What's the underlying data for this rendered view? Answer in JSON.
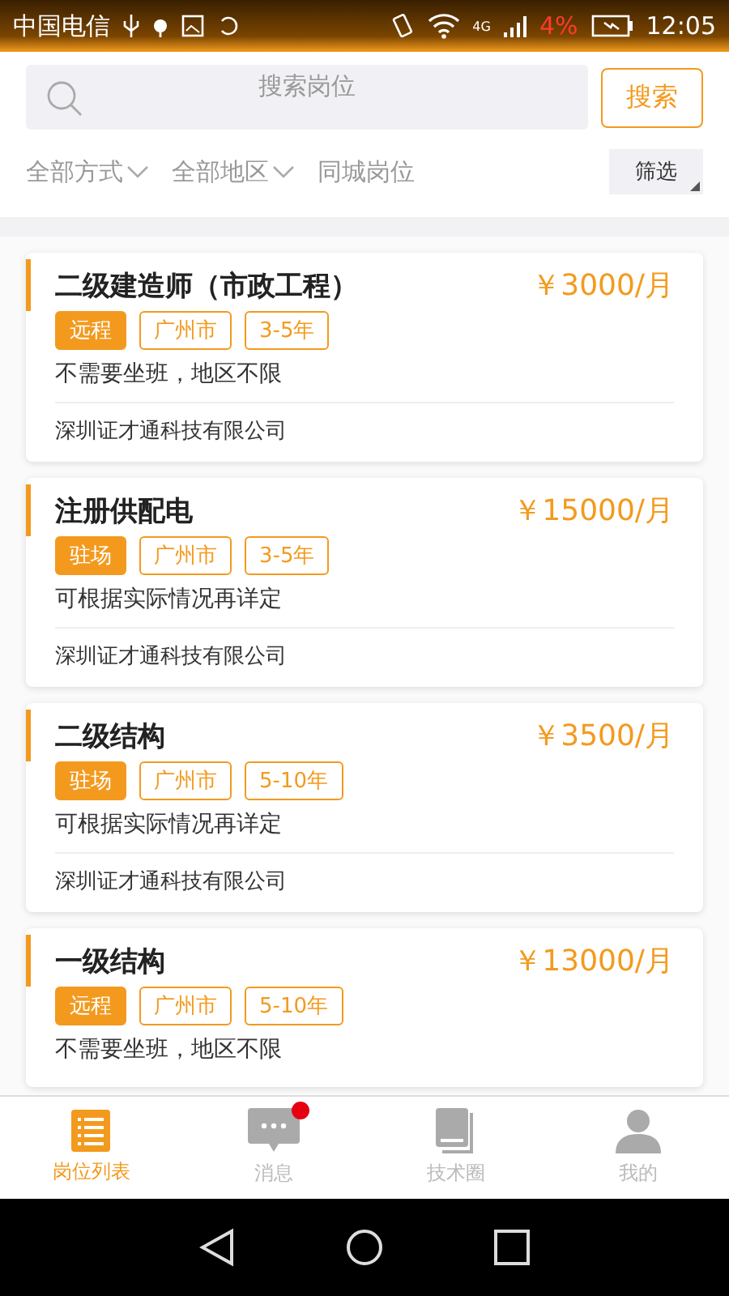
{
  "status_bar": {
    "carrier": "中国电信",
    "network": "4G",
    "battery": "4%",
    "time": "12:05"
  },
  "search": {
    "placeholder": "搜索岗位",
    "button": "搜索"
  },
  "filters": [
    {
      "label": "全部方式",
      "dropdown": true
    },
    {
      "label": "全部地区",
      "dropdown": true
    },
    {
      "label": "同城岗位",
      "dropdown": false
    }
  ],
  "filter_button": "筛选",
  "jobs": [
    {
      "title": "二级建造师（市政工程）",
      "salary": "￥3000/月",
      "tags": [
        {
          "label": "远程",
          "kind": "filled"
        },
        {
          "label": "广州市",
          "kind": "outline"
        },
        {
          "label": "3-5年",
          "kind": "outline"
        }
      ],
      "description": "不需要坐班，地区不限",
      "company": "深圳证才通科技有限公司"
    },
    {
      "title": "注册供配电",
      "salary": "￥15000/月",
      "tags": [
        {
          "label": "驻场",
          "kind": "filled"
        },
        {
          "label": "广州市",
          "kind": "outline"
        },
        {
          "label": "3-5年",
          "kind": "outline"
        }
      ],
      "description": "可根据实际情况再详定",
      "company": "深圳证才通科技有限公司"
    },
    {
      "title": "二级结构",
      "salary": "￥3500/月",
      "tags": [
        {
          "label": "驻场",
          "kind": "filled"
        },
        {
          "label": "广州市",
          "kind": "outline"
        },
        {
          "label": "5-10年",
          "kind": "outline"
        }
      ],
      "description": "可根据实际情况再详定",
      "company": "深圳证才通科技有限公司"
    },
    {
      "title": "一级结构",
      "salary": "￥13000/月",
      "tags": [
        {
          "label": "远程",
          "kind": "filled"
        },
        {
          "label": "广州市",
          "kind": "outline"
        },
        {
          "label": "5-10年",
          "kind": "outline"
        }
      ],
      "description": "不需要坐班，地区不限"
    }
  ],
  "tab_bar": [
    {
      "label": "岗位列表",
      "kind": "list",
      "selected": true,
      "badge": false
    },
    {
      "label": "消息",
      "kind": "chat",
      "selected": false,
      "badge": true
    },
    {
      "label": "技术圈",
      "kind": "book",
      "selected": false,
      "badge": false
    },
    {
      "label": "我的",
      "kind": "person",
      "selected": false,
      "badge": false
    }
  ]
}
